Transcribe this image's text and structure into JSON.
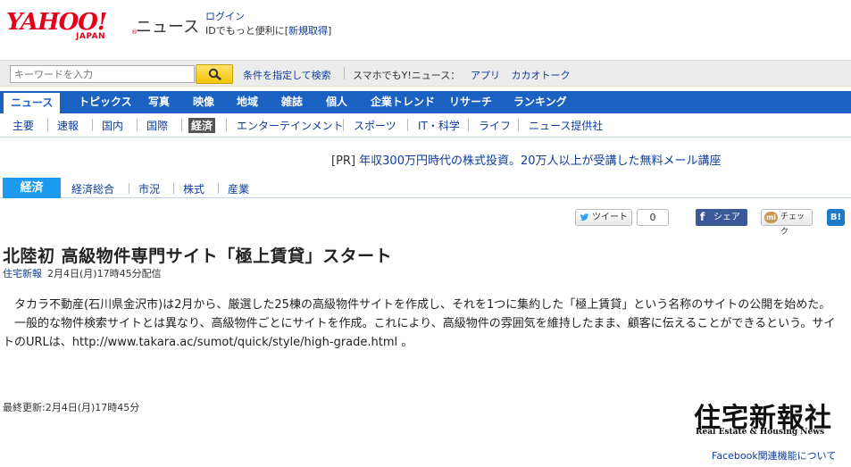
{
  "header": {
    "logo_main": "YAHOO!",
    "logo_sub": "JAPAN",
    "logo_reg": "®",
    "section_title": "ニュース",
    "login_label": "ログイン",
    "login_desc_prefix": "IDでもっと便利に[",
    "signup_label": "新規取得",
    "login_desc_suffix": "]"
  },
  "search": {
    "placeholder": "キーワードを入力",
    "advanced_label": "条件を指定して検索",
    "smartphone_label": "スマホでもY!ニュース：",
    "app_links": [
      "アプリ",
      "カカオトーク"
    ]
  },
  "main_nav": {
    "items": [
      "ニュース",
      "トピックス",
      "写真",
      "映像",
      "地域",
      "雑誌",
      "個人",
      "企業トレンド",
      "リサーチ",
      "ランキング"
    ],
    "active": "ニュース"
  },
  "sub_nav": {
    "items": [
      "主要",
      "速報",
      "国内",
      "国際",
      "経済",
      "エンターテインメント",
      "スポーツ",
      "IT・科学",
      "ライフ",
      "ニュース提供社"
    ],
    "active": "経済"
  },
  "pr": {
    "tag": "[PR]",
    "text": "年収300万円時代の株式投資。20万人以上が受講した無料メール講座"
  },
  "category": {
    "label": "経済",
    "items": [
      "経済総合",
      "市況",
      "株式",
      "産業"
    ]
  },
  "social": {
    "tweet_label": "ツイート",
    "tweet_count": "0",
    "share_icon": "f",
    "share_label": "シェア",
    "check_icon": "mi",
    "check_label": "チェック",
    "hatena_label": "B!"
  },
  "article": {
    "headline": "北陸初 高級物件専門サイト「極上賃貸」スタート",
    "source": "住宅新報",
    "published": "2月4日(月)17時45分配信",
    "paragraphs": [
      "　タカラ不動産(石川県金沢市)は2月から、厳選した25棟の高級物件サイトを作成し、それを1つに集約した「極上賃貸」という名称のサイトの公開を始めた。",
      "　一般的な物件検索サイトとは異なり、高級物件ごとにサイトを作成。これにより、高級物件の雰囲気を維持したまま、顧客に伝えることができるという。サイトのURLは、http://www.takara.ac/sumot/quick/style/high-grade.html 。"
    ],
    "updated": "最終更新:2月4日(月)17時45分"
  },
  "provider": {
    "logo_kanji": "住宅新報社",
    "logo_en": "Real Estate & Housing News"
  },
  "footer": {
    "facebook_link": "Facebook関連機能について"
  },
  "colors": {
    "brand_red": "#e4001b",
    "nav_blue": "#1b61c2",
    "link_blue": "#0d3d9e",
    "category_blue": "#1b9bf0",
    "facebook_blue": "#3b5998"
  }
}
